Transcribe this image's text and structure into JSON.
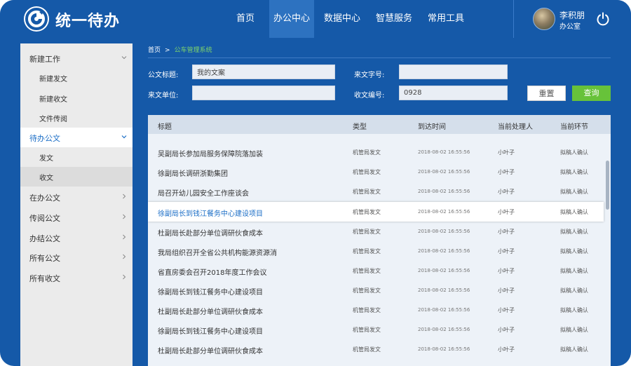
{
  "app": {
    "title": "统一待办"
  },
  "nav": {
    "items": [
      {
        "label": "首页"
      },
      {
        "label": "办公中心",
        "active": true
      },
      {
        "label": "数据中心"
      },
      {
        "label": "智慧服务"
      },
      {
        "label": "常用工具"
      }
    ]
  },
  "user": {
    "name": "李积朋",
    "role": "办公室"
  },
  "sidebar": {
    "items": [
      {
        "label": "新建工作",
        "expanded": true
      },
      {
        "label": "新建发文"
      },
      {
        "label": "新建收文"
      },
      {
        "label": "文件传阅"
      },
      {
        "label": "待办公文",
        "expanded": true,
        "active": true
      },
      {
        "label": "发文"
      },
      {
        "label": "收文",
        "selected": true
      },
      {
        "label": "在办公文"
      },
      {
        "label": "传阅公文"
      },
      {
        "label": "办结公文"
      },
      {
        "label": "所有公文"
      },
      {
        "label": "所有收文"
      }
    ]
  },
  "breadcrumb": {
    "home": "首页",
    "separator": ">",
    "current": "公车管理系统"
  },
  "form": {
    "doc_title_label": "公文标题:",
    "doc_title_value": "我的文案",
    "doc_number_label": "来文字号:",
    "doc_number_value": "",
    "source_label": "来文单位:",
    "source_value": "",
    "receive_number_label": "收文编号:",
    "receive_number_value": "0928",
    "reset_label": "重置",
    "search_label": "查询"
  },
  "table": {
    "headers": [
      "标题",
      "类型",
      "到达时间",
      "当前处理人",
      "当前环节"
    ],
    "rows": [
      {
        "title": "吴副局长参加局服务保障院落加装",
        "type": "机管局发文",
        "time": "2018-08-02  16:55:56",
        "handler": "小叶子",
        "stage": "拟稿人确认"
      },
      {
        "title": "徐副局长调研浙勤集团",
        "type": "机管局发文",
        "time": "2018-08-02  16:55:56",
        "handler": "小叶子",
        "stage": "拟稿人确认"
      },
      {
        "title": "局召开幼儿园安全工作座谈会",
        "type": "机管局发文",
        "time": "2018-08-02  16:55:56",
        "handler": "小叶子",
        "stage": "拟稿人确认"
      },
      {
        "title": "徐副局长到钱江餐务中心建设项目",
        "type": "机管局发文",
        "time": "2018-08-02  16:55:56",
        "handler": "小叶子",
        "stage": "拟稿人确认",
        "highlighted": true
      },
      {
        "title": "杜副局长赴部分单位调研伙食成本",
        "type": "机管局发文",
        "time": "2018-08-02  16:55:56",
        "handler": "小叶子",
        "stage": "拟稿人确认"
      },
      {
        "title": "我局组织召开全省公共机构能源资源消",
        "type": "机管局发文",
        "time": "2018-08-02  16:55:56",
        "handler": "小叶子",
        "stage": "拟稿人确认"
      },
      {
        "title": "省直房委会召开2018年度工作会议",
        "type": "机管局发文",
        "time": "2018-08-02  16:55:56",
        "handler": "小叶子",
        "stage": "拟稿人确认"
      },
      {
        "title": "徐副局长到钱江餐务中心建设项目",
        "type": "机管局发文",
        "time": "2018-08-02  16:55:56",
        "handler": "小叶子",
        "stage": "拟稿人确认"
      },
      {
        "title": "杜副局长赴部分单位调研伙食成本",
        "type": "机管局发文",
        "time": "2018-08-02  16:55:56",
        "handler": "小叶子",
        "stage": "拟稿人确认"
      },
      {
        "title": "徐副局长到钱江餐务中心建设项目",
        "type": "机管局发文",
        "time": "2018-08-02  16:55:56",
        "handler": "小叶子",
        "stage": "拟稿人确认"
      },
      {
        "title": "杜副局长赴部分单位调研伙食成本",
        "type": "机管局发文",
        "time": "2018-08-02  16:55:56",
        "handler": "小叶子",
        "stage": "拟稿人确认"
      }
    ]
  },
  "colors": {
    "header_bg": "#1559a8",
    "nav_active_bg": "#2d72c0",
    "accent_blue": "#1d6fc7",
    "search_button": "#67c23a",
    "breadcrumb_current": "#7fd56b"
  },
  "icons": [
    "logo-icon",
    "power-icon",
    "chevron-down-icon",
    "chevron-right-icon"
  ]
}
